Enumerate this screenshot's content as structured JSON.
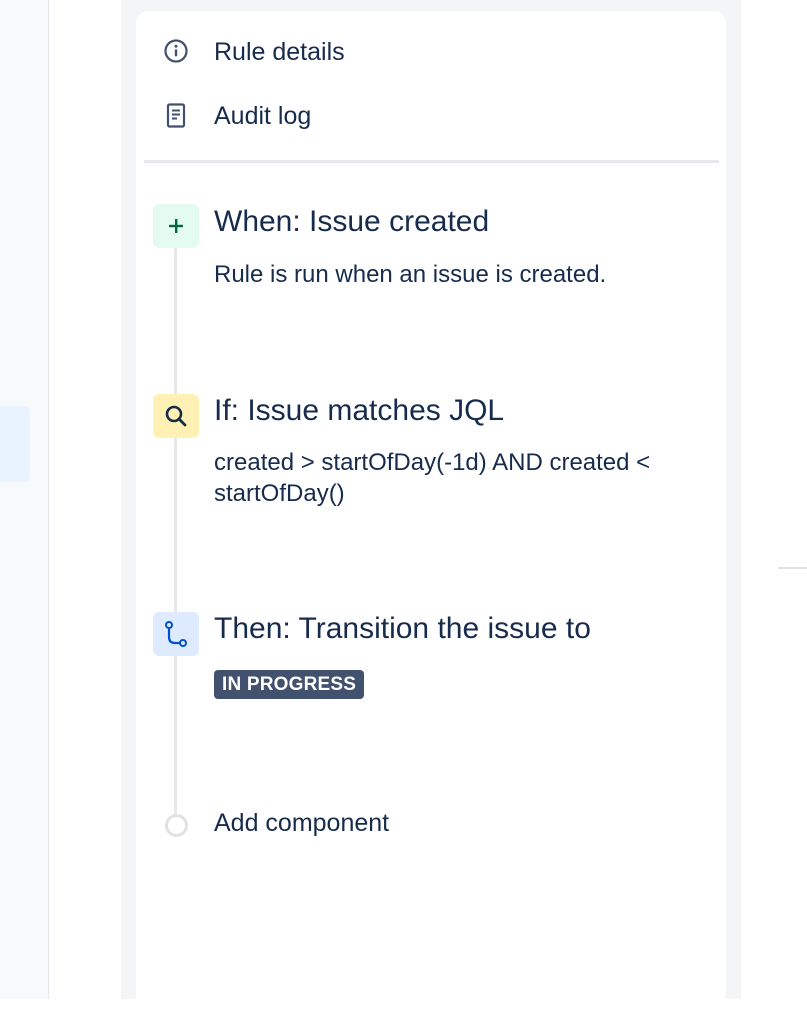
{
  "menu": {
    "rule_details": {
      "label": "Rule details",
      "icon": "info-icon"
    },
    "audit_log": {
      "label": "Audit log",
      "icon": "document-icon"
    }
  },
  "components": {
    "trigger": {
      "title": "When: Issue created",
      "description": "Rule is run when an issue is created.",
      "icon": "plus-icon",
      "icon_bg": "#e3fcef",
      "icon_color": "#006644"
    },
    "condition": {
      "title": "If: Issue matches JQL",
      "description": "created > startOfDay(-1d) AND created < startOfDay()",
      "icon": "search-icon",
      "icon_bg": "#fff0b3",
      "icon_color": "#172b4d"
    },
    "action": {
      "title": "Then: Transition the issue to",
      "status": "IN PROGRESS",
      "icon": "branch-icon",
      "icon_bg": "#deebff",
      "icon_color": "#0052cc"
    }
  },
  "add_component": {
    "label": "Add component"
  }
}
